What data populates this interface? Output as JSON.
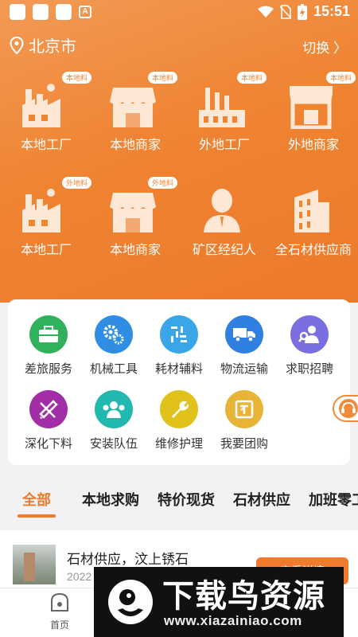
{
  "status_bar": {
    "time": "15:51",
    "app_badge": "A"
  },
  "location": {
    "city": "北京市",
    "switch_label": "切换 〉"
  },
  "categories": [
    {
      "label": "本地工厂",
      "badge": "本地料",
      "icon": "factory-icon"
    },
    {
      "label": "本地商家",
      "badge": "本地料",
      "icon": "shop-icon"
    },
    {
      "label": "外地工厂",
      "badge": "本地料",
      "icon": "industrial-plant-icon"
    },
    {
      "label": "外地商家",
      "badge": "本地料",
      "icon": "storefront-icon"
    },
    {
      "label": "本地工厂",
      "badge": "外地料",
      "icon": "factory-icon"
    },
    {
      "label": "本地商家",
      "badge": "外地料",
      "icon": "shop-icon"
    },
    {
      "label": "矿区经纪人",
      "badge": "",
      "icon": "person-icon"
    },
    {
      "label": "全石材供应商",
      "badge": "",
      "icon": "building-icon"
    }
  ],
  "services": [
    {
      "label": "差旅服务",
      "color": "#2fb25b",
      "icon": "briefcase-icon"
    },
    {
      "label": "机械工具",
      "color": "#2f8de4",
      "icon": "gears-icon"
    },
    {
      "label": "耗材辅料",
      "color": "#3aa6e8",
      "icon": "grid-tools-icon"
    },
    {
      "label": "物流运输",
      "color": "#2f80e0",
      "icon": "truck-icon"
    },
    {
      "label": "求职招聘",
      "color": "#7a6fe0",
      "icon": "job-seeker-icon"
    },
    {
      "label": "深化下料",
      "color": "#a12ea6",
      "icon": "ruler-pencil-icon"
    },
    {
      "label": "安装队伍",
      "color": "#21b8b0",
      "icon": "team-icon"
    },
    {
      "label": "维修护理",
      "color": "#e0c21a",
      "icon": "wrench-icon"
    },
    {
      "label": "我要团购",
      "color": "#e8b437",
      "icon": "group-buy-icon"
    }
  ],
  "tabs": [
    "全部",
    "本地求购",
    "特价现货",
    "石材供应",
    "加班零工"
  ],
  "list_items": [
    {
      "title": "石材供应，汶上锈石",
      "date": "2022",
      "button": "查看详情"
    }
  ],
  "bottom_nav": {
    "home_label": "首页"
  },
  "watermark": {
    "title": "下载鸟资源",
    "url": "www.xiazainiao.com"
  },
  "colors": {
    "accent": "#ef7a2b",
    "hero": "#ef8432"
  }
}
